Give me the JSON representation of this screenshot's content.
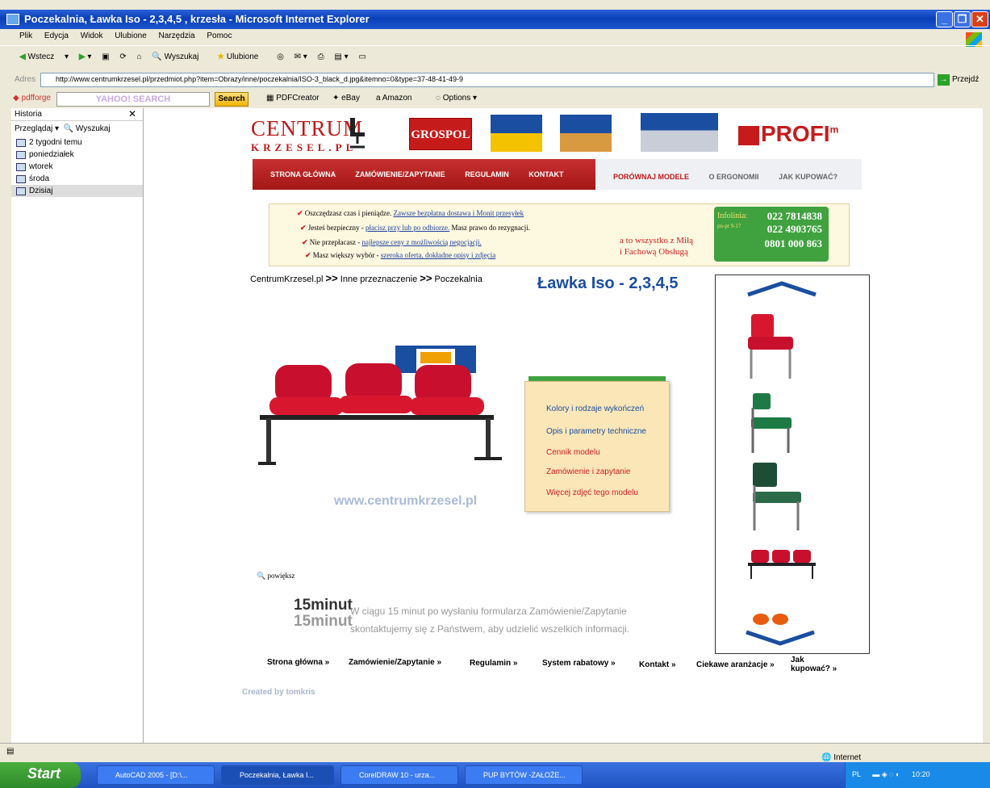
{
  "window": {
    "title": "Poczekalnia, Ławka Iso - 2,3,4,5 , krzesła - Microsoft Internet Explorer"
  },
  "menu": [
    "Plik",
    "Edycja",
    "Widok",
    "Ulubione",
    "Narzędzia",
    "Pomoc"
  ],
  "toolbar": {
    "back": "Wstecz",
    "search": "Wyszukaj",
    "favorites": "Ulubione"
  },
  "address": {
    "label": "Adres",
    "url": "http://www.centrumkrzesel.pl/przedmiot.php?item=Obrazy/inne/poczekalnia/ISO-3_black_d.jpg&itemno=0&type=37-48-41-49-9",
    "go": "Przejdź"
  },
  "yahoo": {
    "search_placeholder": "YAHOO! SEARCH",
    "search_btn": "Search",
    "pdfcreator": "PDFCreator",
    "ebay": "eBay",
    "amazon": "Amazon",
    "options": "Options"
  },
  "sidebar": {
    "title": "Historia",
    "browse": "Przeglądaj",
    "search": "Wyszukaj",
    "items": [
      "2 tygodni temu",
      "poniedziałek",
      "wtorek",
      "środa",
      "Dzisiaj"
    ]
  },
  "page": {
    "logo_main": "CENTRUM",
    "logo_sub": "KRZESEL.PL",
    "grospol": "GROSPOL",
    "profim": "PROFI",
    "profim_sup": "m",
    "nav_red": [
      "STRONA GŁÓWNA",
      "ZAMÓWIENIE/ZAPYTANIE",
      "REGULAMIN",
      "KONTAKT"
    ],
    "nav_grey": [
      "PORÓWNAJ MODELE",
      "O ERGONOMII",
      "JAK KUPOWAĆ?"
    ],
    "benefits": [
      {
        "plain": "Oszczędzasz czas i pieniądze. ",
        "link": "Zawsze bezpłatna dostawa i Monit przesyłek",
        "after": ""
      },
      {
        "plain": "Jesteś bezpieczny - ",
        "link": "płacisz przy lub po odbiorze.",
        "after": " Masz prawo do rezygnacji."
      },
      {
        "plain": "Nie przepłacasz - ",
        "link": "najlepsze ceny z możliwością negocjacji.",
        "after": ""
      },
      {
        "plain": "Masz większy wybór - ",
        "link": "szeroka oferta, dokładne opisy i zdjęcia",
        "after": ""
      }
    ],
    "slogan": [
      "a to wszystko z Miłą",
      "i Fachową Obsługą"
    ],
    "infolinia": {
      "label": "Infolinia:",
      "hours": "pn-pt 9-17",
      "phone1": "022 7814838",
      "phone2": "022 4903765",
      "phone3": "0801 000 863"
    },
    "breadcrumb": [
      "CentrumKrzesel.pl",
      "Inne przeznaczenie",
      "Poczekalnia"
    ],
    "breadcrumb_sep": ">>",
    "product_title": "Ławka Iso - 2,3,4,5",
    "watermark": "www.centrumkrzesel.pl",
    "product_menu": [
      "Kolory i rodzaje wykończeń",
      "Opis i parametry techniczne",
      "Cennik modelu",
      "Zamówienie i zapytanie",
      "Więcej zdjęć tego modelu"
    ],
    "zoom": "powiększ",
    "promo_logo": "15minut",
    "promo_lines": [
      "W ciągu 15 minut po wysłaniu formularza Zamówienie/Zapytanie",
      "skontaktujemy się z Państwem, aby udzielić wszelkich informacji."
    ],
    "footer": [
      "Strona główna »",
      "Zamówienie/Zapytanie »",
      "Regulamin »",
      "System rabatowy »",
      "Kontakt »",
      "Ciekawe aranżacje »",
      "Jak kupować? »"
    ],
    "credit": "Created by tomkris"
  },
  "status": {
    "zone": "Internet"
  },
  "taskbar": {
    "start": "Start",
    "tasks": [
      "AutoCAD 2005 - [D:\\...",
      "Poczekalnia, Ławka I...",
      "CorelDRAW 10 - urza...",
      "PUP BYTÓW -ZAŁOŻE..."
    ],
    "lang": "PL",
    "clock": "10:20"
  },
  "colors": {
    "xp_blue": "#0a3fb8",
    "nav_red": "#b01c1c",
    "title_blue": "#1a4ea0",
    "info_green": "#3fa23f"
  }
}
